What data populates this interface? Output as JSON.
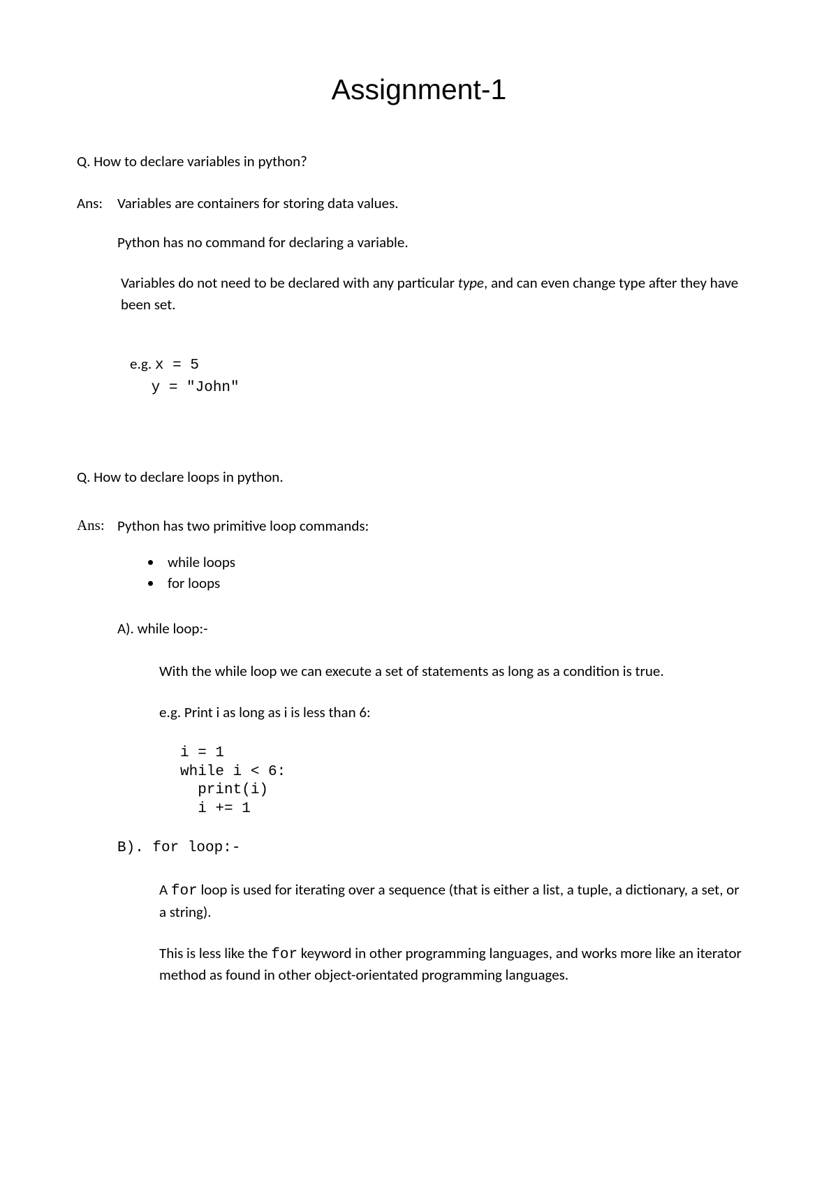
{
  "title": "Assignment-1",
  "q1": {
    "question": "Q. How to declare variables in python?",
    "ans_label": "Ans:",
    "line1": "Variables are containers for storing data values.",
    "line2": "Python has no command for declaring a variable.",
    "line3_prefix": "Variables do not need to be declared with any particular ",
    "line3_italic": "type",
    "line3_suffix": ", and can even change type after they have been set.",
    "eg_prefix": "e.g. ",
    "code_x": "x = 5",
    "code_y": "y = \"John\""
  },
  "q2": {
    "question": "Q. How to declare loops in python.",
    "ans_label": "Ans:",
    "intro": "Python has two primitive loop commands:",
    "bullet1": "while loops",
    "bullet2": "for loops",
    "a_heading": "A). while loop:-",
    "a_body": "With the while loop we can execute a set of statements as long as a condition is true.",
    "a_eg": "e.g. Print i as long as i is less than 6:",
    "a_code": "i = 1\nwhile i < 6:\n  print(i)\n  i += 1",
    "b_heading": "B). for loop:-",
    "b_body1_prefix": "A ",
    "b_body1_mono": "for",
    "b_body1_suffix": " loop is used for iterating over a sequence (that is either a   list, a tuple, a dictionary, a set, or a string).",
    "b_body2_prefix": "This is less like the ",
    "b_body2_mono": "for",
    "b_body2_suffix": " keyword in other programming languages, and works more like an iterator method as found in other object-orientated programming languages."
  }
}
